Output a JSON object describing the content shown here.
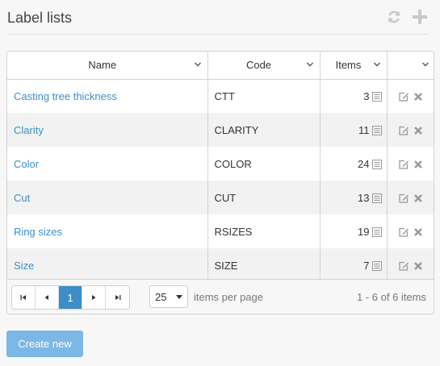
{
  "header": {
    "title": "Label lists"
  },
  "grid": {
    "columns": [
      {
        "label": "Name"
      },
      {
        "label": "Code"
      },
      {
        "label": "Items"
      },
      {
        "label": ""
      }
    ],
    "rows": [
      {
        "name": "Casting tree thickness",
        "code": "CTT",
        "items": "3"
      },
      {
        "name": "Clarity",
        "code": "CLARITY",
        "items": "11"
      },
      {
        "name": "Color",
        "code": "COLOR",
        "items": "24"
      },
      {
        "name": "Cut",
        "code": "CUT",
        "items": "13"
      },
      {
        "name": "Ring sizes",
        "code": "RSIZES",
        "items": "19"
      },
      {
        "name": "Size",
        "code": "SIZE",
        "items": "7"
      }
    ]
  },
  "pager": {
    "current_page": "1",
    "page_size": "25",
    "per_page_label": "items per page",
    "info": "1 - 6 of 6 items"
  },
  "footer": {
    "create_label": "Create new"
  },
  "colors": {
    "accent": "#3d8ec7",
    "button": "#7cb7e6",
    "icon_gray": "#9a9a9a"
  }
}
